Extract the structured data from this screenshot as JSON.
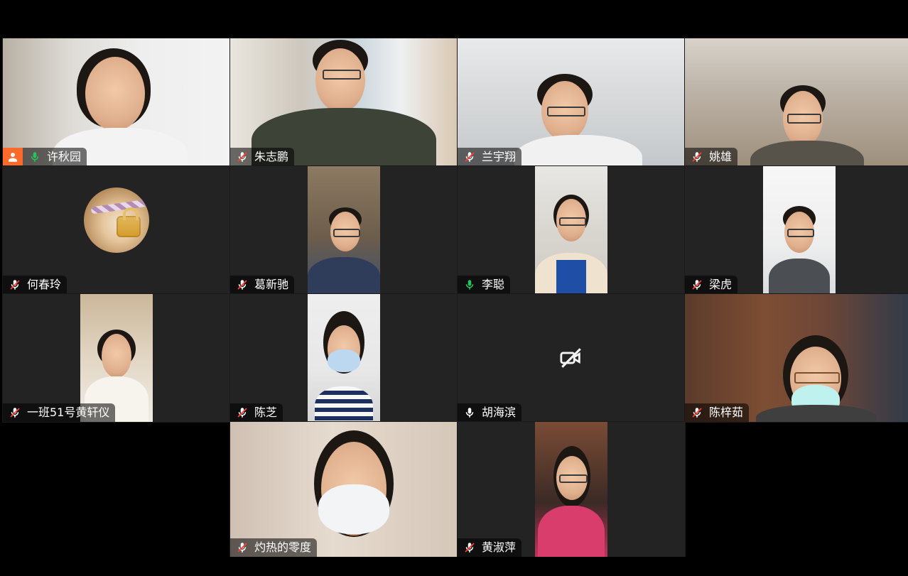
{
  "participants": [
    {
      "name": "许秋园",
      "mic": "on",
      "is_host": true,
      "active_speaker": true
    },
    {
      "name": "朱志鹏",
      "mic": "muted"
    },
    {
      "name": "兰宇翔",
      "mic": "muted"
    },
    {
      "name": "姚雄",
      "mic": "muted"
    },
    {
      "name": "何春玲",
      "mic": "muted",
      "avatar": "profile-picture"
    },
    {
      "name": "葛新驰",
      "mic": "muted"
    },
    {
      "name": "李聪",
      "mic": "on"
    },
    {
      "name": "梁虎",
      "mic": "muted"
    },
    {
      "name": "一班51号黄轩仪",
      "mic": "muted"
    },
    {
      "name": "陈芝",
      "mic": "muted"
    },
    {
      "name": "胡海滨",
      "mic": "on",
      "camera": "off"
    },
    {
      "name": "陈梓茹",
      "mic": "muted"
    },
    {
      "name": "灼热的零度",
      "mic": "muted"
    },
    {
      "name": "黄淑萍",
      "mic": "muted"
    }
  ],
  "colors": {
    "active_speaker_border": "#23d959",
    "host_badge": "#ff6a2a",
    "muted_red": "#ff3b30",
    "mic_green": "#22c55e",
    "tile_bg": "#232323"
  },
  "icons": {
    "mic_on": "mic-on-icon",
    "mic_muted": "mic-muted-icon",
    "host": "host-icon",
    "camera_off": "camera-off-icon"
  }
}
